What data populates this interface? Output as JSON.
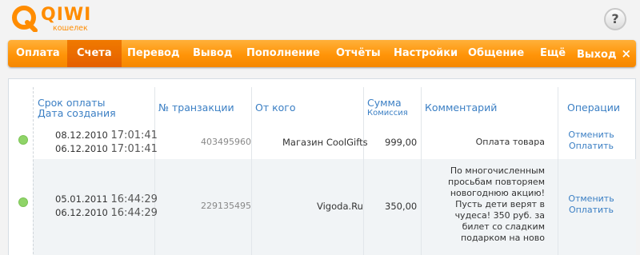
{
  "logo": {
    "brand": "QIWI",
    "subtitle": "кошелек"
  },
  "help": {
    "label": "?"
  },
  "nav": {
    "items": [
      "Оплата",
      "Счета",
      "Перевод",
      "Вывод",
      "Пополнение",
      "Отчёты",
      "Настройки",
      "Общение",
      "Ещё",
      "Выход"
    ],
    "active": "Счета",
    "exit_icon": "×"
  },
  "table": {
    "headers": {
      "due_date": "Срок оплаты",
      "created_date": "Дата создания",
      "transaction": "№ транзакции",
      "from": "От кого",
      "amount": "Сумма",
      "commission": "Комиссия",
      "comment": "Комментарий",
      "operations": "Операции"
    },
    "rows": [
      {
        "status": "green",
        "due_date": "08.12.2010",
        "due_time": "17:01:41",
        "created_date": "06.12.2010",
        "created_time": "17:01:41",
        "transaction": "403495960",
        "from": "Магазин CoolGifts",
        "amount": "999,00",
        "comment": [
          "Оплата товара"
        ],
        "ops": [
          "Отменить",
          "Оплатить"
        ]
      },
      {
        "status": "green",
        "due_date": "05.01.2011",
        "due_time": "16:44:29",
        "created_date": "06.12.2010",
        "created_time": "16:44:29",
        "transaction": "229135495",
        "from": "Vigoda.Ru",
        "amount": "350,00",
        "comment": [
          "По многочисленным",
          "просьбам повторяем",
          "новогоднюю акцию!",
          "Пусть дети верят в",
          "чудеса! 350 руб. за",
          "билет со сладким",
          "подарком на ново"
        ],
        "ops": [
          "Отменить",
          "Оплатить"
        ]
      }
    ]
  },
  "colors": {
    "accent": "#ff9408",
    "active_tab": "#e55f00",
    "link": "#3b7fc4",
    "status_green": "#8fd468"
  }
}
